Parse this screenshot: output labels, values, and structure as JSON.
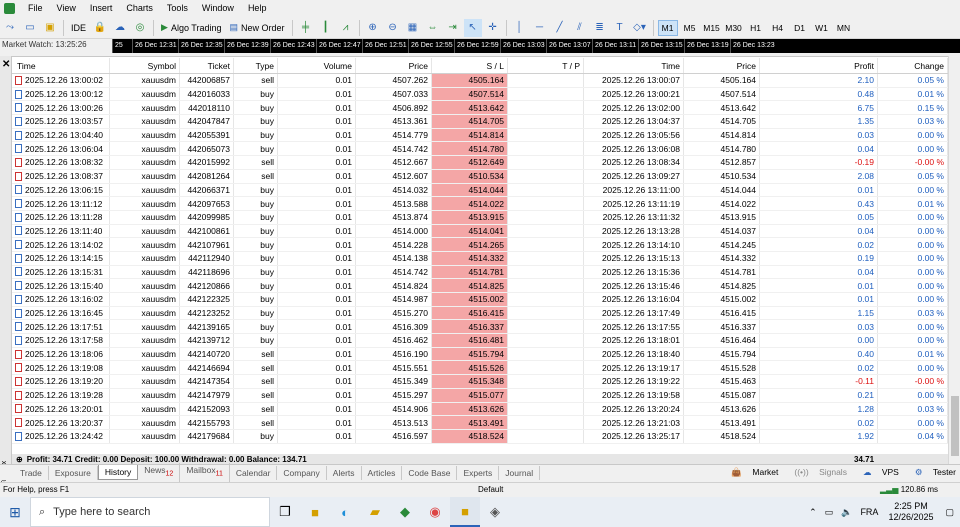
{
  "menu": [
    "File",
    "View",
    "Insert",
    "Charts",
    "Tools",
    "Window",
    "Help"
  ],
  "toolbar": {
    "ide_label": "IDE",
    "algo_trading_label": "Algo Trading",
    "new_order_label": "New Order",
    "timeframes": [
      "M1",
      "M5",
      "M15",
      "M30",
      "H1",
      "H4",
      "D1",
      "W1",
      "MN"
    ],
    "active_timeframe": "M1"
  },
  "market_watch_title": "Market Watch: 13:25:26",
  "chart_strip": [
    "25",
    "26 Dec 12:31",
    "26 Dec 12:35",
    "26 Dec 12:39",
    "26 Dec 12:43",
    "26 Dec 12:47",
    "26 Dec 12:51",
    "26 Dec 12:55",
    "26 Dec 12:59",
    "26 Dec 13:03",
    "26 Dec 13:07",
    "26 Dec 13:11",
    "26 Dec 13:15",
    "26 Dec 13:19",
    "26 Dec 13:23"
  ],
  "table": {
    "headers": [
      "Time",
      "Symbol",
      "Ticket",
      "Type",
      "Volume",
      "Price",
      "S / L",
      "T / P",
      "Time",
      "Price",
      "Profit",
      "Change"
    ],
    "rows": [
      [
        "2025.12.26 13:00:02",
        "xauusdm",
        "442006857",
        "sell",
        "0.01",
        "4507.262",
        "4505.164",
        "",
        "2025.12.26 13:00:07",
        "4505.164",
        "2.10",
        "0.05 %"
      ],
      [
        "2025.12.26 13:00:12",
        "xauusdm",
        "442016033",
        "buy",
        "0.01",
        "4507.033",
        "4507.514",
        "",
        "2025.12.26 13:00:21",
        "4507.514",
        "0.48",
        "0.01 %"
      ],
      [
        "2025.12.26 13:00:26",
        "xauusdm",
        "442018110",
        "buy",
        "0.01",
        "4506.892",
        "4513.642",
        "",
        "2025.12.26 13:02:00",
        "4513.642",
        "6.75",
        "0.15 %"
      ],
      [
        "2025.12.26 13:03:57",
        "xauusdm",
        "442047847",
        "buy",
        "0.01",
        "4513.361",
        "4514.705",
        "",
        "2025.12.26 13:04:37",
        "4514.705",
        "1.35",
        "0.03 %"
      ],
      [
        "2025.12.26 13:04:40",
        "xauusdm",
        "442055391",
        "buy",
        "0.01",
        "4514.779",
        "4514.814",
        "",
        "2025.12.26 13:05:56",
        "4514.814",
        "0.03",
        "0.00 %"
      ],
      [
        "2025.12.26 13:06:04",
        "xauusdm",
        "442065073",
        "buy",
        "0.01",
        "4514.742",
        "4514.780",
        "",
        "2025.12.26 13:06:08",
        "4514.780",
        "0.04",
        "0.00 %"
      ],
      [
        "2025.12.26 13:08:32",
        "xauusdm",
        "442015992",
        "sell",
        "0.01",
        "4512.667",
        "4512.649",
        "",
        "2025.12.26 13:08:34",
        "4512.857",
        "-0.19",
        "-0.00 %"
      ],
      [
        "2025.12.26 13:08:37",
        "xauusdm",
        "442081264",
        "sell",
        "0.01",
        "4512.607",
        "4510.534",
        "",
        "2025.12.26 13:09:27",
        "4510.534",
        "2.08",
        "0.05 %"
      ],
      [
        "2025.12.26 13:06:15",
        "xauusdm",
        "442066371",
        "buy",
        "0.01",
        "4514.032",
        "4514.044",
        "",
        "2025.12.26 13:11:00",
        "4514.044",
        "0.01",
        "0.00 %"
      ],
      [
        "2025.12.26 13:11:12",
        "xauusdm",
        "442097653",
        "buy",
        "0.01",
        "4513.588",
        "4514.022",
        "",
        "2025.12.26 13:11:19",
        "4514.022",
        "0.43",
        "0.01 %"
      ],
      [
        "2025.12.26 13:11:28",
        "xauusdm",
        "442099985",
        "buy",
        "0.01",
        "4513.874",
        "4513.915",
        "",
        "2025.12.26 13:11:32",
        "4513.915",
        "0.05",
        "0.00 %"
      ],
      [
        "2025.12.26 13:11:40",
        "xauusdm",
        "442100861",
        "buy",
        "0.01",
        "4514.000",
        "4514.041",
        "",
        "2025.12.26 13:13:28",
        "4514.037",
        "0.04",
        "0.00 %"
      ],
      [
        "2025.12.26 13:14:02",
        "xauusdm",
        "442107961",
        "buy",
        "0.01",
        "4514.228",
        "4514.265",
        "",
        "2025.12.26 13:14:10",
        "4514.245",
        "0.02",
        "0.00 %"
      ],
      [
        "2025.12.26 13:14:15",
        "xauusdm",
        "442112940",
        "buy",
        "0.01",
        "4514.138",
        "4514.332",
        "",
        "2025.12.26 13:15:13",
        "4514.332",
        "0.19",
        "0.00 %"
      ],
      [
        "2025.12.26 13:15:31",
        "xauusdm",
        "442118696",
        "buy",
        "0.01",
        "4514.742",
        "4514.781",
        "",
        "2025.12.26 13:15:36",
        "4514.781",
        "0.04",
        "0.00 %"
      ],
      [
        "2025.12.26 13:15:40",
        "xauusdm",
        "442120866",
        "buy",
        "0.01",
        "4514.824",
        "4514.825",
        "",
        "2025.12.26 13:15:46",
        "4514.825",
        "0.01",
        "0.00 %"
      ],
      [
        "2025.12.26 13:16:02",
        "xauusdm",
        "442122325",
        "buy",
        "0.01",
        "4514.987",
        "4515.002",
        "",
        "2025.12.26 13:16:04",
        "4515.002",
        "0.01",
        "0.00 %"
      ],
      [
        "2025.12.26 13:16:45",
        "xauusdm",
        "442123252",
        "buy",
        "0.01",
        "4515.270",
        "4516.415",
        "",
        "2025.12.26 13:17:49",
        "4516.415",
        "1.15",
        "0.03 %"
      ],
      [
        "2025.12.26 13:17:51",
        "xauusdm",
        "442139165",
        "buy",
        "0.01",
        "4516.309",
        "4516.337",
        "",
        "2025.12.26 13:17:55",
        "4516.337",
        "0.03",
        "0.00 %"
      ],
      [
        "2025.12.26 13:17:58",
        "xauusdm",
        "442139712",
        "buy",
        "0.01",
        "4516.462",
        "4516.481",
        "",
        "2025.12.26 13:18:01",
        "4516.464",
        "0.00",
        "0.00 %"
      ],
      [
        "2025.12.26 13:18:06",
        "xauusdm",
        "442140720",
        "sell",
        "0.01",
        "4516.190",
        "4515.794",
        "",
        "2025.12.26 13:18:40",
        "4515.794",
        "0.40",
        "0.01 %"
      ],
      [
        "2025.12.26 13:19:08",
        "xauusdm",
        "442146694",
        "sell",
        "0.01",
        "4515.551",
        "4515.526",
        "",
        "2025.12.26 13:19:17",
        "4515.528",
        "0.02",
        "0.00 %"
      ],
      [
        "2025.12.26 13:19:20",
        "xauusdm",
        "442147354",
        "sell",
        "0.01",
        "4515.349",
        "4515.348",
        "",
        "2025.12.26 13:19:22",
        "4515.463",
        "-0.11",
        "-0.00 %"
      ],
      [
        "2025.12.26 13:19:28",
        "xauusdm",
        "442147979",
        "sell",
        "0.01",
        "4515.297",
        "4515.077",
        "",
        "2025.12.26 13:19:58",
        "4515.087",
        "0.21",
        "0.00 %"
      ],
      [
        "2025.12.26 13:20:01",
        "xauusdm",
        "442152093",
        "sell",
        "0.01",
        "4514.906",
        "4513.626",
        "",
        "2025.12.26 13:20:24",
        "4513.626",
        "1.28",
        "0.03 %"
      ],
      [
        "2025.12.26 13:20:37",
        "xauusdm",
        "442155793",
        "sell",
        "0.01",
        "4513.513",
        "4513.491",
        "",
        "2025.12.26 13:21:03",
        "4513.491",
        "0.02",
        "0.00 %"
      ],
      [
        "2025.12.26 13:24:42",
        "xauusdm",
        "442179684",
        "buy",
        "0.01",
        "4516.597",
        "4518.524",
        "",
        "2025.12.26 13:25:17",
        "4518.524",
        "1.92",
        "0.04 %"
      ]
    ]
  },
  "summary": {
    "text": "Profit: 34.71  Credit: 0.00  Deposit: 100.00  Withdrawal: 0.00  Balance: 134.71",
    "total": "34.71"
  },
  "tabs": [
    {
      "label": "Trade",
      "badge": ""
    },
    {
      "label": "Exposure",
      "badge": ""
    },
    {
      "label": "History",
      "badge": "",
      "active": true
    },
    {
      "label": "News",
      "badge": "12"
    },
    {
      "label": "Mailbox",
      "badge": "11"
    },
    {
      "label": "Calendar",
      "badge": ""
    },
    {
      "label": "Company",
      "badge": ""
    },
    {
      "label": "Alerts",
      "badge": ""
    },
    {
      "label": "Articles",
      "badge": ""
    },
    {
      "label": "Code Base",
      "badge": ""
    },
    {
      "label": "Experts",
      "badge": ""
    },
    {
      "label": "Journal",
      "badge": ""
    }
  ],
  "right_tools": {
    "market": "Market",
    "signals": "Signals",
    "vps": "VPS",
    "tester": "Tester"
  },
  "toolbox_label": "Toolbox",
  "status": {
    "help": "For Help, press F1",
    "profile": "Default",
    "ping": "120.86 ms"
  },
  "taskbar": {
    "search_placeholder": "Type here to search",
    "lang": "FRA",
    "time": "2:25 PM",
    "date": "12/26/2025"
  },
  "colors": {
    "sl_highlight": "#f4a6a6",
    "positive": "#1f5fbf",
    "negative": "#dd1111"
  }
}
